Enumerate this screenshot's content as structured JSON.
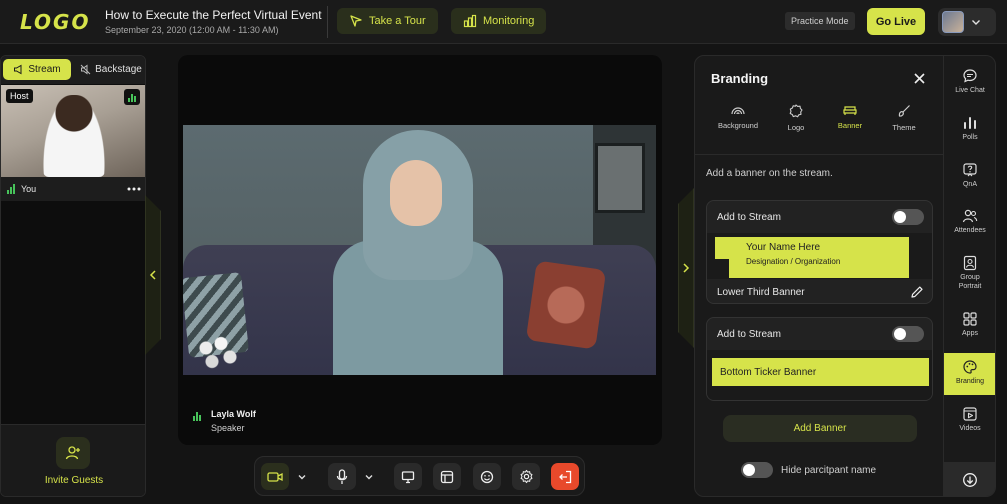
{
  "header": {
    "logo_text": "LOGO",
    "event_title": "How to Execute the Perfect Virtual Event",
    "event_date": "September 23, 2020 (12:00 AM - 11:30 AM)",
    "take_tour_label": "Take a Tour",
    "monitoring_label": "Monitoring",
    "practice_mode_label": "Practice Mode",
    "go_live_label": "Go Live"
  },
  "left_panel": {
    "tabs": [
      {
        "label": "Stream",
        "icon": "megaphone-icon",
        "active": true
      },
      {
        "label": "Backstage",
        "icon": "muted-speaker-icon",
        "active": false
      }
    ],
    "host_badge": "Host",
    "self_label": "You",
    "invite_label": "Invite Guests"
  },
  "stage": {
    "speaker_name": "Layla Wolf",
    "speaker_role": "Speaker"
  },
  "branding": {
    "title": "Branding",
    "tabs": [
      {
        "label": "Background",
        "icon": "rainbow-icon"
      },
      {
        "label": "Logo",
        "icon": "badge-icon"
      },
      {
        "label": "Banner",
        "icon": "sofa-icon",
        "active": true
      },
      {
        "label": "Theme",
        "icon": "brush-icon"
      }
    ],
    "description": "Add a banner on the stream.",
    "card1": {
      "add_to_stream_label": "Add to Stream",
      "banner_line1": "Your Name Here",
      "banner_line2": "Designation / Organization",
      "banner_name": "Lower Third Banner"
    },
    "card2": {
      "add_to_stream_label": "Add to Stream",
      "banner_text": "Bottom Ticker Banner"
    },
    "add_banner_label": "Add Banner",
    "hide_participant_label": "Hide parcitpant name"
  },
  "rail": {
    "items": [
      {
        "label": "Live Chat",
        "icon": "chat-icon"
      },
      {
        "label": "Polls",
        "icon": "bar-chart-icon"
      },
      {
        "label": "QnA",
        "icon": "question-icon"
      },
      {
        "label": "Attendees",
        "icon": "people-icon"
      },
      {
        "label": "Group Portrait",
        "icon": "portrait-icon"
      },
      {
        "label": "Apps",
        "icon": "apps-icon"
      },
      {
        "label": "Branding",
        "icon": "palette-icon",
        "active": true
      },
      {
        "label": "Videos",
        "icon": "video-icon"
      }
    ]
  },
  "colors": {
    "accent": "#d6e34a",
    "background": "#141414",
    "panel": "#1a1a1a",
    "leave": "#e8492b",
    "audio_level": "#47c35a"
  }
}
